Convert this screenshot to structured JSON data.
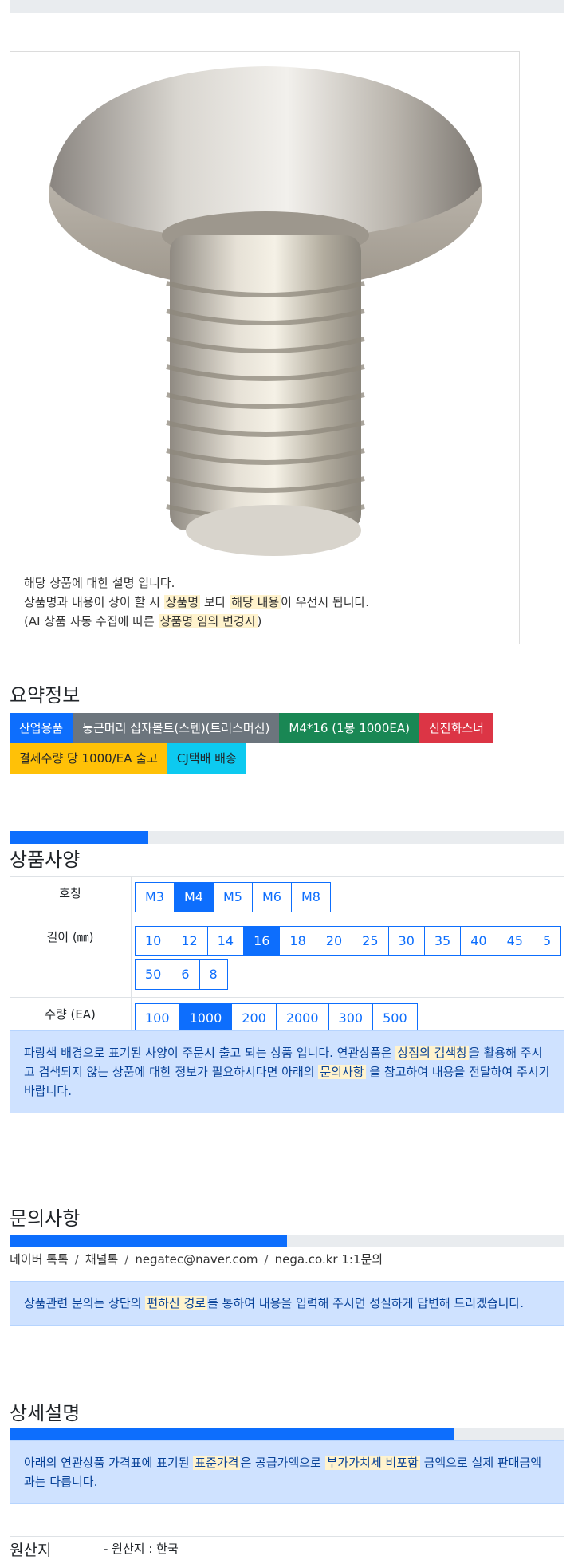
{
  "image_note": {
    "line1": "해당 상품에 대한 설명 입니다.",
    "line2_a": "상품명과 내용이 상이 할 시 ",
    "line2_hl1": "상품명",
    "line2_b": " 보다 ",
    "line2_hl2": "해당 내용",
    "line2_c": "이 우선시 됩니다.",
    "line3_a": "(AI 상품 자동 수집에 따른 ",
    "line3_hl": "상품명 임의 변경시",
    "line3_b": ")"
  },
  "summary": {
    "title": "요약정보",
    "badges": [
      {
        "label": "산업용품",
        "color": "#0d6efd"
      },
      {
        "label": "둥근머리 십자볼트(스텐)(트러스머신)",
        "color": "#6c757d"
      },
      {
        "label": "M4*16 (1봉 1000EA)",
        "color": "#198754"
      },
      {
        "label": "신진화스너",
        "color": "#dc3545"
      },
      {
        "label": "결제수량 당 1000/EA 출고",
        "color": "#ffc107"
      },
      {
        "label": "CJ택배 배송",
        "color": "#0dcaf0"
      }
    ]
  },
  "spec": {
    "progress": 0.25,
    "title": "상품사양",
    "rows": [
      {
        "label": "호칭",
        "options": [
          "M3",
          "M4",
          "M5",
          "M6",
          "M8"
        ],
        "selected": "M4"
      },
      {
        "label": "길이 (㎜)",
        "options": [
          "10",
          "12",
          "14",
          "16",
          "18",
          "20",
          "25",
          "30",
          "35",
          "40",
          "45",
          "5",
          "50",
          "6",
          "8"
        ],
        "selected": "16"
      },
      {
        "label": "수량 (EA)",
        "options": [
          "100",
          "1000",
          "200",
          "2000",
          "300",
          "500"
        ],
        "selected": "1000"
      }
    ],
    "notice_a": "파랑색 배경으로 표기된 사양이 주문시 출고 되는 상품 입니다. 연관상품은 ",
    "notice_hl1": "상점의 검색창",
    "notice_b": "을 활용해 주시고 검색되지 않는 상품에 대한 정보가 필요하시다면 아래의 ",
    "notice_hl2": "문의사항",
    "notice_c": " 을 참고하여 내용을 전달하여 주시기 바랍니다."
  },
  "inquiry": {
    "title": "문의사항",
    "progress": 0.5,
    "channels": [
      "네이버 톡톡",
      "채널톡",
      "negatec@naver.com",
      "nega.co.kr 1:1문의"
    ],
    "notice_a": "상품관련 문의는 상단의 ",
    "notice_hl": "편하신 경로",
    "notice_b": "를 통하여 내용을 입력해 주시면 성실하게 답변해 드리겠습니다."
  },
  "detail": {
    "title": "상세설명",
    "progress": 0.8,
    "notice_a": "아래의 연관상품 가격표에 표기된 ",
    "notice_hl1": "표준가격",
    "notice_b": "은 공급가액으로 ",
    "notice_hl2": "부가가치세 비포함",
    "notice_c": " 금액으로 실제 판매금액과는 다릅니다."
  },
  "origin": {
    "label": "원산지",
    "value": "- 원산지 : 한국"
  }
}
